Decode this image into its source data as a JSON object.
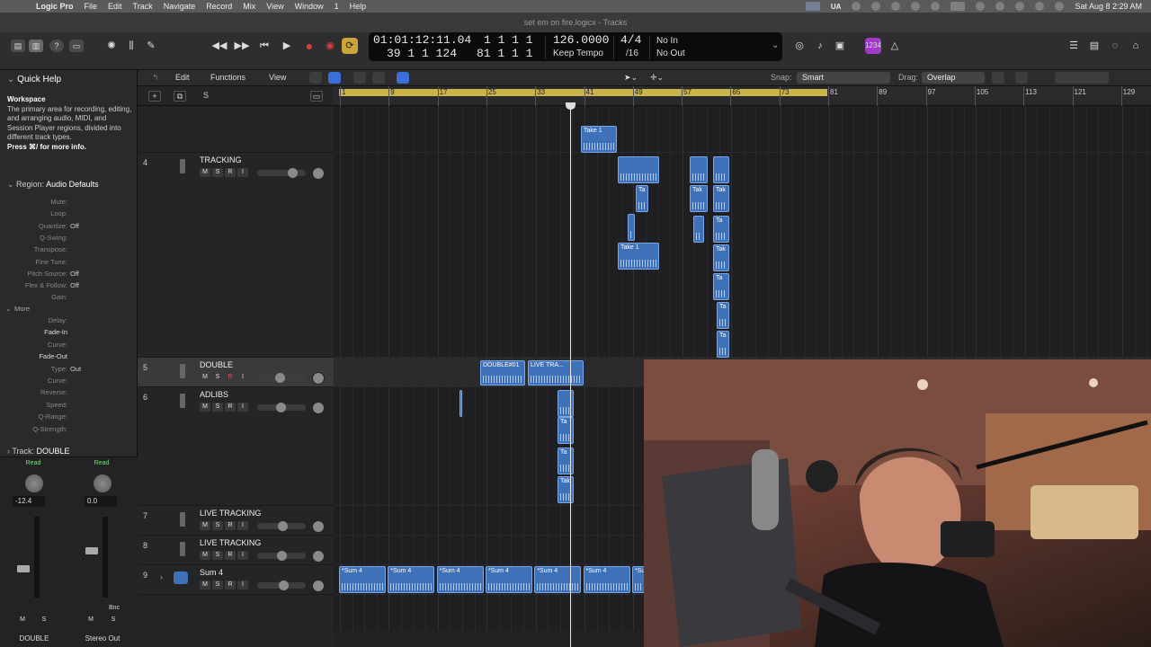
{
  "menubar": {
    "app": "Logic Pro",
    "items": [
      "File",
      "Edit",
      "Track",
      "Navigate",
      "Record",
      "Mix",
      "View",
      "Window",
      "1",
      "Help"
    ],
    "status_ua": "UA",
    "clock": "Sat Aug 8  2:29 AM"
  },
  "window": {
    "title": "set em on fire.logicx - Tracks"
  },
  "lcd": {
    "position_time": "01:01:12:11.04",
    "position_bars_top": "1  1  1     1",
    "position_bars_bottom": "39  1  1  124",
    "position_bars_end": "81  1  1     1",
    "tempo": "126.0000",
    "tempo_label": "Keep Tempo",
    "signature": "4/4",
    "division": "/16",
    "in": "No In",
    "out": "No Out"
  },
  "toolbar": {
    "badge": "1234"
  },
  "inspector": {
    "quick_help_title": "Quick Help",
    "quick_help_heading": "Workspace",
    "quick_help_text": "The primary area for recording, editing, and arranging audio, MIDI, and Session Player regions, divided into different track types.",
    "quick_help_more": "Press ⌘/ for more info.",
    "region_prefix": "Region:",
    "region_name": "Audio Defaults",
    "params": [
      {
        "k": "Mute:",
        "v": ""
      },
      {
        "k": "Loop:",
        "v": ""
      },
      {
        "k": "Quantize:",
        "v": "Off"
      },
      {
        "k": "Q-Swing:",
        "v": ""
      },
      {
        "k": "Transpose:",
        "v": ""
      },
      {
        "k": "Fine Tune:",
        "v": ""
      },
      {
        "k": "Pitch Source:",
        "v": "Off"
      },
      {
        "k": "Flex & Follow:",
        "v": "Off"
      },
      {
        "k": "Gain:",
        "v": ""
      }
    ],
    "more_label": "More",
    "more_params": [
      {
        "k": "Delay:",
        "v": ""
      },
      {
        "k": "Fade-In",
        "v": ""
      },
      {
        "k": "Curve:",
        "v": ""
      },
      {
        "k": "Fade-Out",
        "v": ""
      },
      {
        "k": "Type:",
        "v": "Out"
      },
      {
        "k": "Curve:",
        "v": ""
      },
      {
        "k": "Reverse:",
        "v": ""
      },
      {
        "k": "Speed:",
        "v": ""
      },
      {
        "k": "Q-Range:",
        "v": ""
      },
      {
        "k": "Q-Strength:",
        "v": ""
      }
    ],
    "track_prefix": "Track:",
    "track_name": "DOUBLE"
  },
  "strips": [
    {
      "read": "Read",
      "volume": "-12.4",
      "m": "M",
      "s": "S",
      "name": "DOUBLE"
    },
    {
      "read": "Read",
      "volume": "0.0",
      "m": "M",
      "s": "S",
      "bnc": "Bnc",
      "name": "Stereo Out"
    }
  ],
  "editbar": {
    "edit": "Edit",
    "functions": "Functions",
    "view": "View",
    "snap_label": "Snap:",
    "snap_value": "Smart",
    "drag_label": "Drag:",
    "drag_value": "Overlap"
  },
  "ruler": [
    "1",
    "9",
    "17",
    "25",
    "33",
    "41",
    "49",
    "57",
    "65",
    "73",
    "81",
    "89",
    "97",
    "105",
    "113",
    "121",
    "129"
  ],
  "tracks": [
    {
      "num": "4",
      "name": "TRACKING"
    },
    {
      "num": "5",
      "name": "DOUBLE"
    },
    {
      "num": "6",
      "name": "ADLIBS"
    },
    {
      "num": "7",
      "name": "LIVE TRACKING"
    },
    {
      "num": "8",
      "name": "LIVE TRACKING"
    },
    {
      "num": "9",
      "name": "Sum 4"
    }
  ],
  "regions": {
    "take1_top": "Take 1",
    "take1_mid": "Take 1",
    "double": "DOUBLE#01",
    "live": "LIVE TRA...",
    "sum": "*Sum 4",
    "sum_last": "*Su",
    "ta": "Ta",
    "tak": "Tak"
  },
  "colors": {
    "region": "#3f71b8",
    "cycle": "#c9b44a",
    "record": "#e03b3b",
    "accent": "#3a6fd8"
  }
}
